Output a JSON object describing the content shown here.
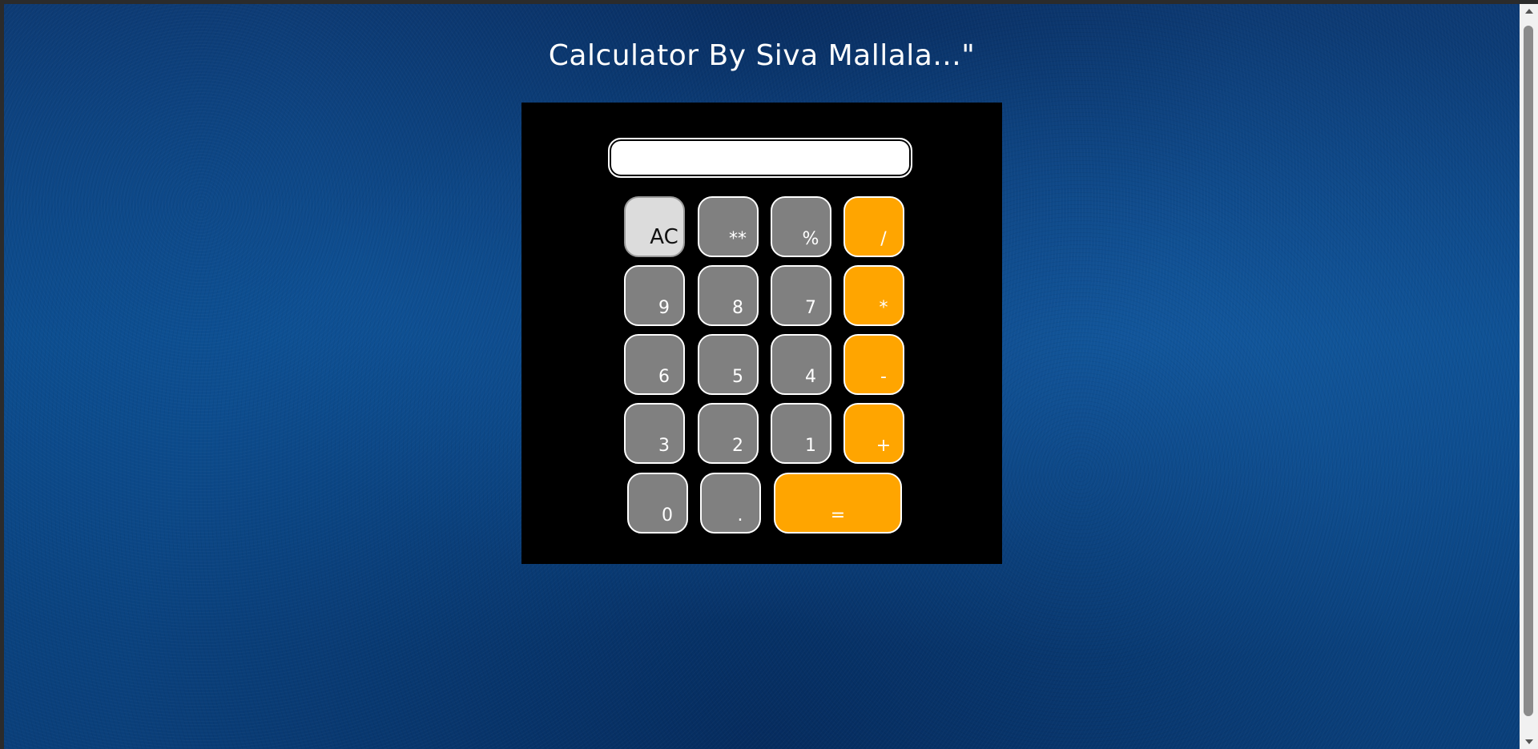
{
  "page": {
    "title": "Calculator By Siva Mallala...\""
  },
  "display": {
    "value": "",
    "placeholder": ""
  },
  "keys": {
    "ac": "AC",
    "power": "**",
    "percent": "%",
    "divide": "/",
    "nine": "9",
    "eight": "8",
    "seven": "7",
    "multiply": "*",
    "six": "6",
    "five": "5",
    "four": "4",
    "subtract": "-",
    "three": "3",
    "two": "2",
    "one": "1",
    "add": "+",
    "zero": "0",
    "dot": ".",
    "equals": "="
  },
  "colors": {
    "background": "#0b4a8a",
    "calculator_body": "#000000",
    "number_key": "#808080",
    "operator_key": "#ffa500",
    "clear_key": "#dcdcdc",
    "key_border": "#ffffff"
  }
}
